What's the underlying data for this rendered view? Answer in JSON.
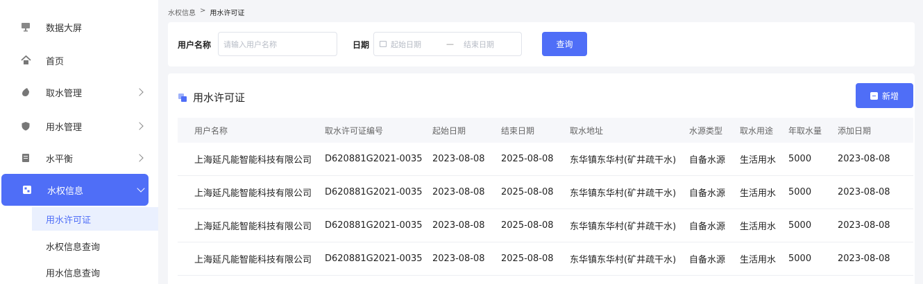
{
  "sidebar": {
    "items": [
      {
        "label": "数据大屏",
        "icon": "monitor-icon",
        "has_chevron": false
      },
      {
        "label": "首页",
        "icon": "home-icon",
        "has_chevron": false
      },
      {
        "label": "取水管理",
        "icon": "water-drop-icon",
        "has_chevron": true
      },
      {
        "label": "用水管理",
        "icon": "shield-icon",
        "has_chevron": true
      },
      {
        "label": "水平衡",
        "icon": "document-icon",
        "has_chevron": true
      },
      {
        "label": "水权信息",
        "icon": "grid-icon",
        "has_chevron": true,
        "active": true
      }
    ],
    "sub_items": [
      {
        "label": "用水许可证",
        "active": true
      },
      {
        "label": "水权信息查询"
      },
      {
        "label": "用水信息查询"
      }
    ]
  },
  "breadcrumb": {
    "parent": "水权信息",
    "separator": ">",
    "current": "用水许可证"
  },
  "filter": {
    "user_label": "用户名称",
    "user_placeholder": "请输入用户名称",
    "date_label": "日期",
    "start_placeholder": "起始日期",
    "range_separator": "—",
    "end_placeholder": "结束日期",
    "query_label": "查询"
  },
  "panel": {
    "title": "用水许可证",
    "add_label": "新增"
  },
  "table": {
    "headers": [
      "用户名称",
      "取水许可证编号",
      "起始日期",
      "结束日期",
      "取水地址",
      "水源类型",
      "取水用途",
      "年取水量",
      "添加日期"
    ],
    "rows": [
      [
        "上海延凡能智能科技有限公司",
        "D620881G2021-0035",
        "2023-08-08",
        "2025-08-08",
        "东华镇东华村(矿井疏干水)",
        "自备水源",
        "生活用水",
        "5000",
        "2023-08-08"
      ],
      [
        "上海延凡能智能科技有限公司",
        "D620881G2021-0035",
        "2023-08-08",
        "2025-08-08",
        "东华镇东华村(矿井疏干水)",
        "自备水源",
        "生活用水",
        "5000",
        "2023-08-08"
      ],
      [
        "上海延凡能智能科技有限公司",
        "D620881G2021-0035",
        "2023-08-08",
        "2025-08-08",
        "东华镇东华村(矿井疏干水)",
        "自备水源",
        "生活用水",
        "5000",
        "2023-08-08"
      ],
      [
        "上海延凡能智能科技有限公司",
        "D620881G2021-0035",
        "2023-08-08",
        "2025-08-08",
        "东华镇东华村(矿井疏干水)",
        "自备水源",
        "生活用水",
        "5000",
        "2023-08-08"
      ]
    ]
  },
  "colors": {
    "primary": "#4f6ef7",
    "active_sub_bg": "#eaf0fe",
    "page_bg": "#f4f5f8"
  }
}
